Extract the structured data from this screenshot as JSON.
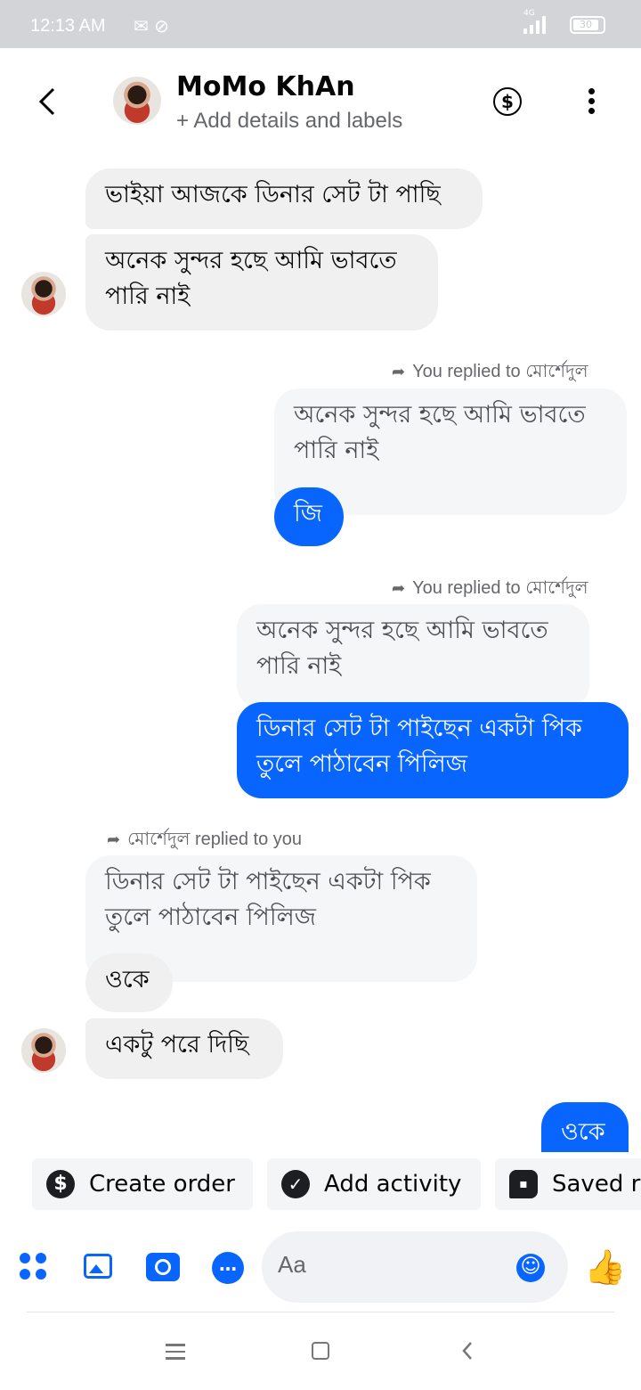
{
  "status_bar": {
    "time": "12:13 AM",
    "network": "4G",
    "battery": "30"
  },
  "header": {
    "contact_name": "MoMo KhAn",
    "subtitle": "+ Add details and labels",
    "dollar_symbol": "$"
  },
  "messages": {
    "m1": "ভাইয়া আজকে ডিনার সেট টা পাছি",
    "m2": "অনেক সুন্দর হছে আমি ভাবতে পারি নাই",
    "reply1_tag": "You replied to মোর্শেদুল",
    "reply1_quote": "অনেক সুন্দর হছে আমি ভাবতে পারি নাই",
    "reply1_text": "জি",
    "reply2_tag": "You replied to মোর্শেদুল",
    "reply2_quote": "অনেক সুন্দর হছে আমি ভাবতে পারি নাই",
    "reply2_text": "ডিনার সেট টা পাইছেন একটা পিক তুলে পাঠাবেন পিলিজ",
    "reply3_tag": "মোর্শেদুল replied to you",
    "reply3_quote": "ডিনার সেট টা পাইছেন একটা পিক তুলে পাঠাবেন পিলিজ",
    "reply3_text": "ওকে",
    "m_last_recv": "একটু পরে দিছি",
    "m_last_sent": "ওকে"
  },
  "quick_actions": {
    "create_order": "Create order",
    "add_activity": "Add activity",
    "saved_replies": "Saved r"
  },
  "composer": {
    "placeholder": "Aa"
  },
  "colors": {
    "messenger_blue": "#0866ff",
    "bubble_gray": "#f0f0f0",
    "status_bar": "#d2d4d8"
  },
  "icons": [
    "back-chevron-icon",
    "dollar-icon",
    "more-icon",
    "menu-dots-icon",
    "image-icon",
    "camera-icon",
    "chat-icon",
    "emoji-icon",
    "like-icon",
    "check-icon",
    "saved-replies-icon"
  ]
}
